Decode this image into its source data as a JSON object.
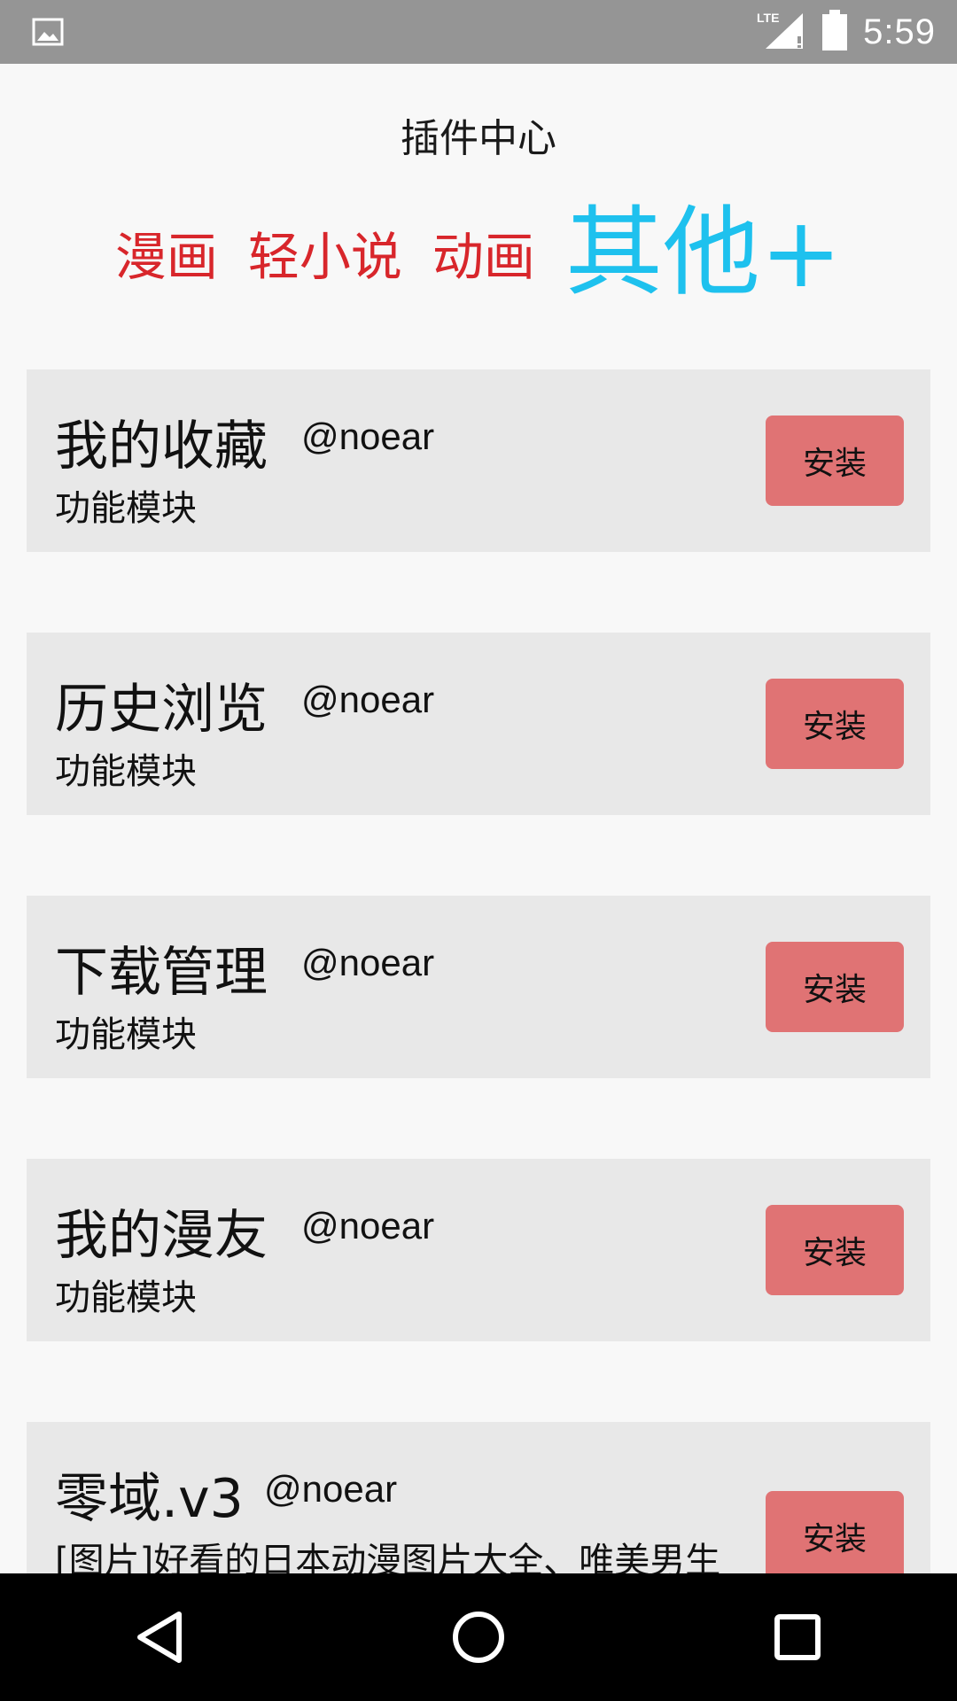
{
  "status_bar": {
    "time": "5:59",
    "icons": [
      "image-icon",
      "lte-signal-icon",
      "battery-icon"
    ]
  },
  "header": {
    "title": "插件中心"
  },
  "tabs": [
    {
      "label": "漫画",
      "active": false
    },
    {
      "label": "轻小说",
      "active": false
    },
    {
      "label": "动画",
      "active": false
    },
    {
      "label": "其他+",
      "active": true
    }
  ],
  "plugins": [
    {
      "name": "我的收藏",
      "author": "@noear",
      "description": "功能模块",
      "button": "安装"
    },
    {
      "name": "历史浏览",
      "author": "@noear",
      "description": "功能模块",
      "button": "安装"
    },
    {
      "name": "下载管理",
      "author": "@noear",
      "description": "功能模块",
      "button": "安装"
    },
    {
      "name": "我的漫友",
      "author": "@noear",
      "description": "功能模块",
      "button": "安装"
    },
    {
      "name": "零域.v3",
      "author": "@noear",
      "description": "[图片]好看的日本动漫图片大全、唯美男生",
      "button": "安装"
    }
  ],
  "colors": {
    "tab_inactive": "#d8262b",
    "tab_active": "#1ec1ee",
    "install_button": "#e07374",
    "card_background": "#e8e8e8",
    "status_bar": "#959595"
  },
  "nav_bar": {
    "icons": [
      "back-icon",
      "home-icon",
      "recents-icon"
    ]
  }
}
